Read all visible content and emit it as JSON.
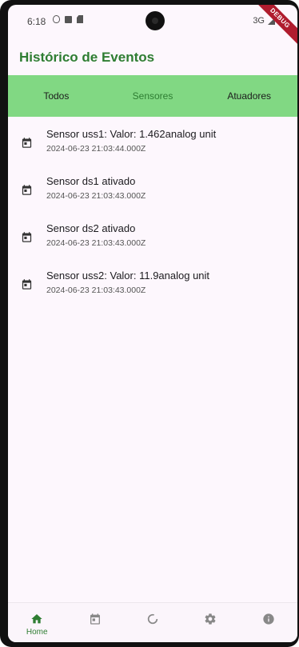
{
  "status_bar": {
    "time": "6:18",
    "network": "3G",
    "debug_label": "DEBUG"
  },
  "app_bar": {
    "title": "Histórico de Eventos"
  },
  "tabs": [
    {
      "label": "Todos",
      "active": false
    },
    {
      "label": "Sensores",
      "active": true
    },
    {
      "label": "Atuadores",
      "active": false
    }
  ],
  "events": [
    {
      "title": "Sensor uss1:  Valor: 1.462analog unit",
      "timestamp": "2024-06-23 21:03:44.000Z",
      "icon": "calendar-icon"
    },
    {
      "title": "Sensor ds1 ativado",
      "timestamp": "2024-06-23 21:03:43.000Z",
      "icon": "calendar-icon"
    },
    {
      "title": "Sensor ds2 ativado",
      "timestamp": "2024-06-23 21:03:43.000Z",
      "icon": "calendar-icon"
    },
    {
      "title": "Sensor uss2:  Valor: 11.9analog unit",
      "timestamp": "2024-06-23 21:03:43.000Z",
      "icon": "calendar-icon"
    }
  ],
  "bottom_nav": [
    {
      "label": "Home",
      "icon": "home-icon",
      "active": true
    },
    {
      "label": "",
      "icon": "calendar-icon",
      "active": false
    },
    {
      "label": "",
      "icon": "progress-circle-icon",
      "active": false
    },
    {
      "label": "",
      "icon": "gear-icon",
      "active": false
    },
    {
      "label": "",
      "icon": "info-icon",
      "active": false
    }
  ],
  "colors": {
    "primary": "#2e7d32",
    "tab_bar_background": "#81d883",
    "background": "#fdf7fd",
    "icon_gray": "#888888"
  }
}
